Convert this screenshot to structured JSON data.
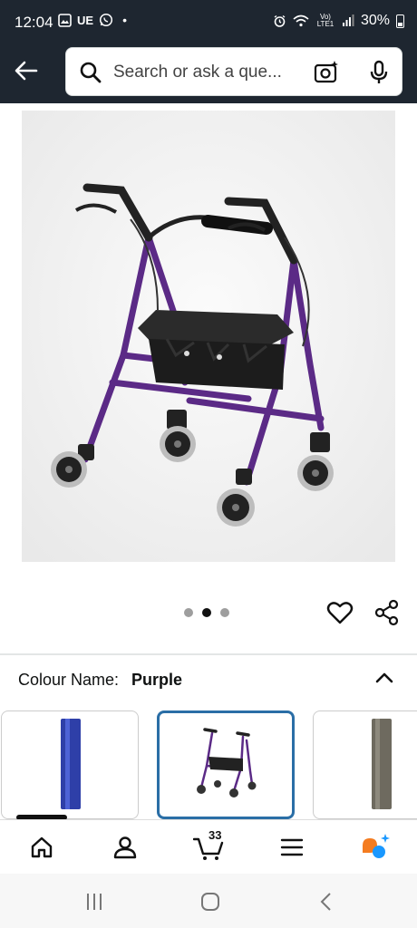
{
  "status_bar": {
    "time": "12:04",
    "carrier_badge": "UE",
    "dot": "•",
    "network_label": "Vo) LTE1",
    "battery": "30%"
  },
  "search": {
    "placeholder": "Search or ask a que..."
  },
  "carousel": {
    "total_images": 3,
    "active_index": 1
  },
  "variation": {
    "label": "Colour Name:",
    "value": "Purple"
  },
  "swatches": [
    {
      "name": "blue-walking-stick",
      "color": "#2e3fa8"
    },
    {
      "name": "purple-rollator",
      "color": "#5b2a86"
    },
    {
      "name": "grey-walking-stick",
      "color": "#6e6a5f"
    }
  ],
  "bottom_nav": {
    "cart_count": "33"
  },
  "colors": {
    "header_bg": "#1e2630",
    "accent_blue": "#2a6ea6",
    "rollator_purple": "#5b2a86",
    "rufus_orange": "#f47c20",
    "rufus_blue": "#1a98ff"
  }
}
